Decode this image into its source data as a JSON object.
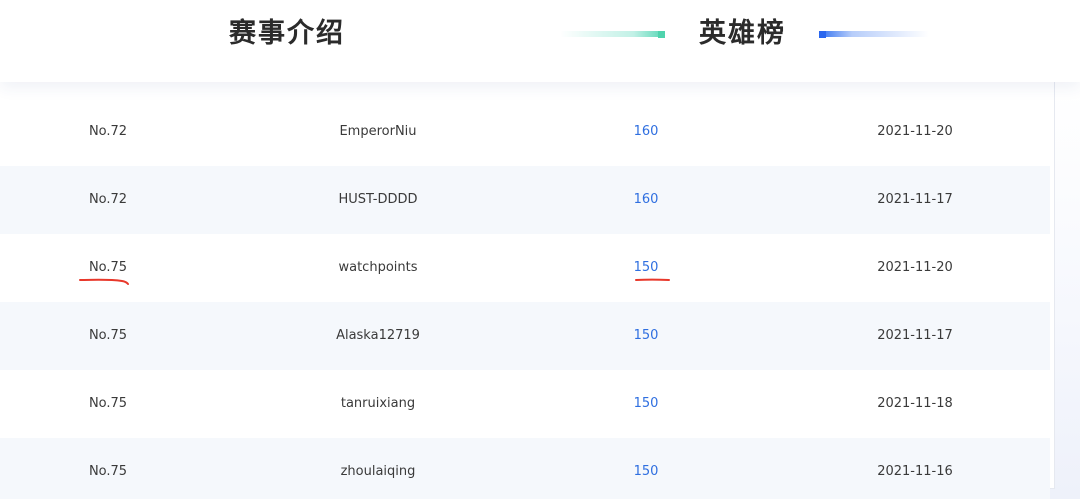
{
  "tabs": {
    "intro_label": "赛事介绍",
    "heroes_label": "英雄榜"
  },
  "colors": {
    "score_blue": "#2f6fe0",
    "accent_teal": "#4fd3ad",
    "accent_blue": "#2a66ee",
    "annotation_red": "#e8382b"
  },
  "leaderboard": {
    "rows": [
      {
        "rank": "No.72",
        "name": "EmperorNiu",
        "score": "160",
        "date": "2021-11-20"
      },
      {
        "rank": "No.72",
        "name": "HUST-DDDD",
        "score": "160",
        "date": "2021-11-17"
      },
      {
        "rank": "No.75",
        "name": "watchpoints",
        "score": "150",
        "date": "2021-11-20"
      },
      {
        "rank": "No.75",
        "name": "Alaska12719",
        "score": "150",
        "date": "2021-11-17"
      },
      {
        "rank": "No.75",
        "name": "tanruixiang",
        "score": "150",
        "date": "2021-11-18"
      },
      {
        "rank": "No.75",
        "name": "zhoulaiqing",
        "score": "150",
        "date": "2021-11-16"
      }
    ]
  }
}
